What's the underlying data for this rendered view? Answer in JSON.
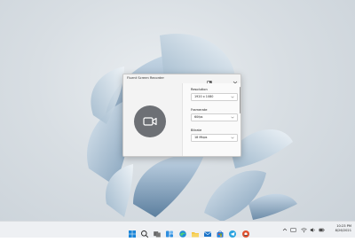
{
  "window": {
    "title": "Fluent Screen Recorder",
    "settings": {
      "resolution_label": "Resolution",
      "resolution_value": "1920 x 1080",
      "framerate_label": "Framerate",
      "framerate_value": "60fps",
      "bitrate_label": "Bitrate",
      "bitrate_value": "18 Mbps"
    }
  },
  "taskbar": {
    "clock_time": "10:23 PM",
    "clock_date": "8/26/2021",
    "apps": [
      "windows-start-icon",
      "search-icon",
      "task-view-icon",
      "widgets-icon",
      "edge-icon",
      "explorer-icon",
      "mail-icon",
      "store-icon",
      "telegram-icon",
      "recorder-app-icon"
    ]
  },
  "colors": {
    "record_button": "#6d7075",
    "taskbar": "#eef0f3",
    "accent": "#0078d4"
  }
}
